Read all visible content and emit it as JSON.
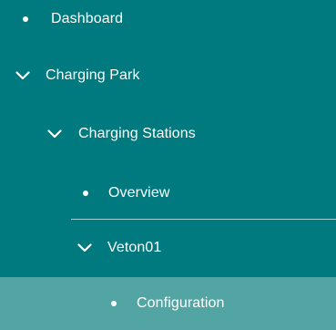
{
  "nav": {
    "items": [
      {
        "label": "Dashboard",
        "icon": "bullet-icon"
      },
      {
        "label": "Charging Park",
        "icon": "chevron-down-icon",
        "expanded": true
      },
      {
        "label": "Charging Stations",
        "icon": "chevron-down-icon",
        "expanded": true
      },
      {
        "label": "Overview",
        "icon": "bullet-icon"
      },
      {
        "label": "Veton01",
        "icon": "chevron-down-icon",
        "expanded": true
      },
      {
        "label": "Configuration",
        "icon": "bullet-icon",
        "active": true
      }
    ]
  },
  "colors": {
    "background": "#007a7e",
    "active_background": "#53a5a4",
    "divider": "#9fd3d3",
    "text": "#ffffff"
  }
}
